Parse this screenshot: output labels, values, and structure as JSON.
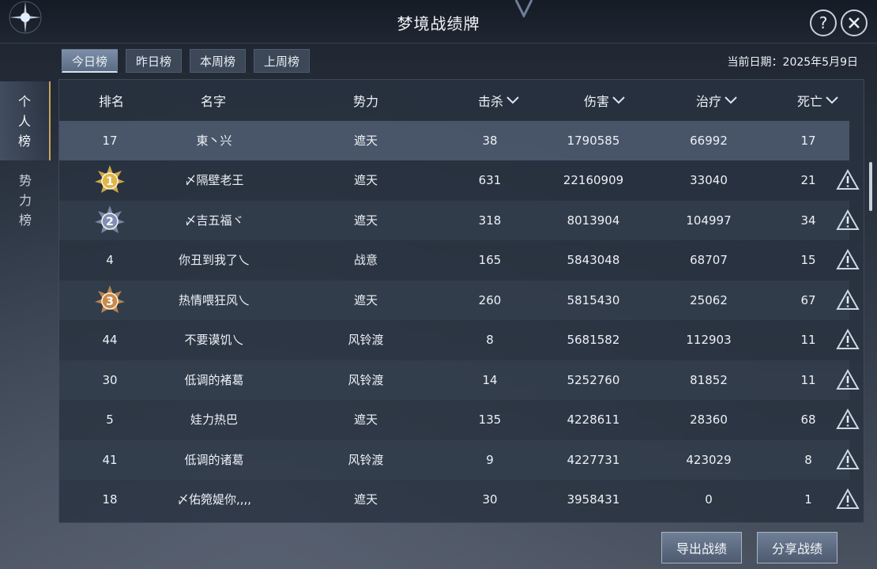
{
  "window": {
    "title": "梦境战绩牌"
  },
  "tabs": [
    "今日榜",
    "昨日榜",
    "本周榜",
    "上周榜"
  ],
  "date": {
    "label": "当前日期：2025年5月9日"
  },
  "side_nav": [
    {
      "chars": [
        "个",
        "人",
        "榜"
      ]
    },
    {
      "chars": [
        "势",
        "力",
        "榜"
      ]
    }
  ],
  "table": {
    "headers": {
      "rank": "排名",
      "name": "名字",
      "faction": "势力",
      "kills": "击杀",
      "damage": "伤害",
      "heal": "治疗",
      "deaths": "死亡"
    },
    "self_row": {
      "rank": "17",
      "name": "東丶兴",
      "faction": "遮天",
      "kills": "38",
      "damage": "1790585",
      "heal": "66992",
      "deaths": "17"
    },
    "rows": [
      {
        "rank": "1",
        "medal": "gold-medal-icon",
        "name": "〆隔壁老王",
        "faction": "遮天",
        "kills": "631",
        "damage": "22160909",
        "heal": "33040",
        "deaths": "21"
      },
      {
        "rank": "2",
        "medal": "silver-medal-icon",
        "name": "〆吉五福ヾ",
        "faction": "遮天",
        "kills": "318",
        "damage": "8013904",
        "heal": "104997",
        "deaths": "34"
      },
      {
        "rank": "4",
        "name": "你丑到我了乀",
        "faction": "战意",
        "kills": "165",
        "damage": "5843048",
        "heal": "68707",
        "deaths": "15"
      },
      {
        "rank": "3",
        "medal": "bronze-medal-icon",
        "name": "热情喂狂风乀",
        "faction": "遮天",
        "kills": "260",
        "damage": "5815430",
        "heal": "25062",
        "deaths": "67"
      },
      {
        "rank": "44",
        "name": "不要谟饥乀",
        "faction": "风铃渡",
        "kills": "8",
        "damage": "5681582",
        "heal": "112903",
        "deaths": "11"
      },
      {
        "rank": "30",
        "name": "低调的褚葛",
        "faction": "风铃渡",
        "kills": "14",
        "damage": "5252760",
        "heal": "81852",
        "deaths": "11"
      },
      {
        "rank": "5",
        "name": "娃力热巴",
        "faction": "遮天",
        "kills": "135",
        "damage": "4228611",
        "heal": "28360",
        "deaths": "68"
      },
      {
        "rank": "41",
        "name": "低调的诸葛",
        "faction": "风铃渡",
        "kills": "9",
        "damage": "4227731",
        "heal": "423029",
        "deaths": "8"
      },
      {
        "rank": "18",
        "name": "〆佑箢媞你,,,,",
        "faction": "遮天",
        "kills": "30",
        "damage": "3958431",
        "heal": "0",
        "deaths": "1"
      }
    ]
  },
  "buttons": {
    "export": "导出战绩",
    "share": "分享战绩"
  },
  "colors": {
    "medal_gold": "#e0b54a",
    "medal_silver": "#7f8fb8",
    "medal_bronze": "#c98a50",
    "accent_gold": "#c8a55b"
  }
}
